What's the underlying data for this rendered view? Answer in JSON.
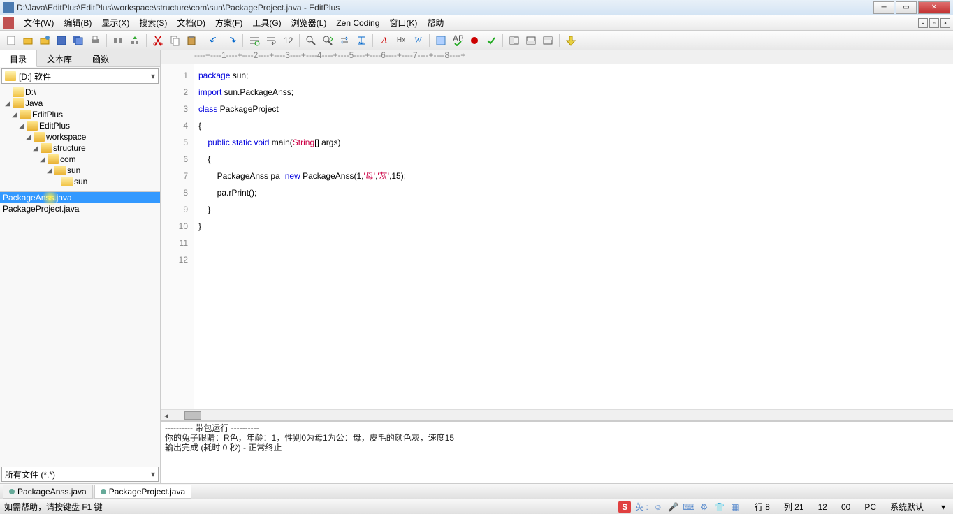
{
  "title": "D:\\Java\\EditPlus\\EditPlus\\workspace\\structure\\com\\sun\\PackageProject.java - EditPlus",
  "menu": [
    "文件(W)",
    "编辑(B)",
    "显示(X)",
    "搜索(S)",
    "文档(D)",
    "方案(F)",
    "工具(G)",
    "浏览器(L)",
    "Zen Coding",
    "窗口(K)",
    "帮助"
  ],
  "side_tabs": {
    "dir": "目录",
    "lib": "文本库",
    "func": "函数"
  },
  "drive": "[D:] 软件",
  "tree": [
    {
      "indent": 0,
      "label": "D:\\",
      "open": false,
      "tw": ""
    },
    {
      "indent": 0,
      "label": "Java",
      "open": true,
      "tw": "◢"
    },
    {
      "indent": 1,
      "label": "EditPlus",
      "open": true,
      "tw": "◢"
    },
    {
      "indent": 2,
      "label": "EditPlus",
      "open": true,
      "tw": "◢"
    },
    {
      "indent": 3,
      "label": "workspace",
      "open": true,
      "tw": "◢"
    },
    {
      "indent": 4,
      "label": "structure",
      "open": true,
      "tw": "◢"
    },
    {
      "indent": 5,
      "label": "com",
      "open": true,
      "tw": "◢"
    },
    {
      "indent": 6,
      "label": "sun",
      "open": true,
      "tw": "◢"
    },
    {
      "indent": 7,
      "label": "sun",
      "open": false,
      "tw": ""
    }
  ],
  "files": [
    {
      "name": "PackageAnss.java",
      "sel": true
    },
    {
      "name": "PackageProject.java",
      "sel": false
    }
  ],
  "filter": "所有文件 (*.*)",
  "ruler": "----+----1----+----2----+----3----+----4----+----5----+----6----+----7----+----8----+",
  "code_lines": 12,
  "output": {
    "l1": "---------- 带包运行 ----------",
    "l2": "你的兔子眼睛：R色，年龄：1，性别0为母1为公：母，皮毛的颜色灰，速度15",
    "l3": "",
    "l4": "输出完成 (耗时 0 秒) - 正常终止"
  },
  "tabs": [
    {
      "name": "PackageAnss.java",
      "active": false
    },
    {
      "name": "PackageProject.java",
      "active": true
    }
  ],
  "status": {
    "help": "如需帮助，请按键盘 F1 键",
    "ime": "英 :",
    "line": "行 8",
    "col": "列 21",
    "tot": "12",
    "sel": "00",
    "mode": "PC",
    "enc": "系统默认"
  }
}
